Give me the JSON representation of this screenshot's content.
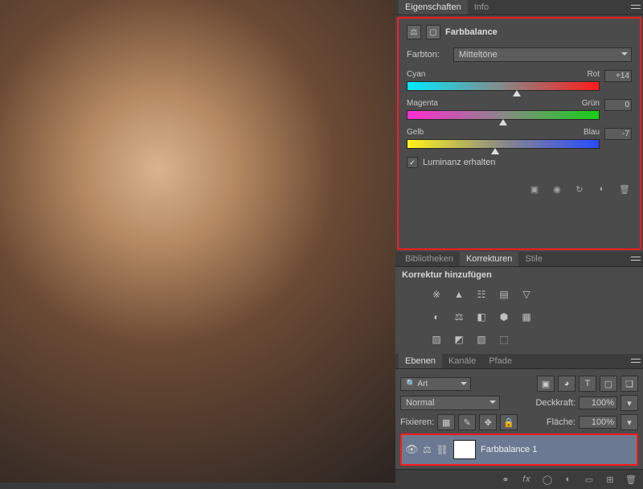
{
  "properties": {
    "tab_eigenschaften": "Eigenschaften",
    "tab_info": "Info",
    "title": "Farbbalance",
    "tone_label": "Farbton:",
    "tone_selected": "Mitteltöne",
    "sliders": {
      "cyan_red": {
        "left": "Cyan",
        "right": "Rot",
        "value": "+14",
        "pos": 57
      },
      "mag_green": {
        "left": "Magenta",
        "right": "Grün",
        "value": "0",
        "pos": 50
      },
      "yel_blue": {
        "left": "Gelb",
        "right": "Blau",
        "value": "-7",
        "pos": 46
      }
    },
    "preserve_lum": "Luminanz erhalten"
  },
  "corrections": {
    "tab_bibliotheken": "Bibliotheken",
    "tab_korrekturen": "Korrekturen",
    "tab_stile": "Stile",
    "heading": "Korrektur hinzufügen",
    "icons_row1": [
      "※",
      "▲",
      "☷",
      "▤",
      "▽"
    ],
    "icons_row2": [
      "◐",
      "⚖",
      "◧",
      "⬢",
      "▦"
    ],
    "icons_row3": [
      "▨",
      "◩",
      "▧",
      "⬚"
    ]
  },
  "layers": {
    "tab_ebenen": "Ebenen",
    "tab_kanaele": "Kanäle",
    "tab_pfade": "Pfade",
    "filter_label": "Art",
    "mode": "Normal",
    "opacity_label": "Deckkraft:",
    "opacity_value": "100%",
    "lock_label": "Fixieren:",
    "fill_label": "Fläche:",
    "fill_value": "100%",
    "layer_name": "Farbbalance 1",
    "filter_icons": [
      "▣",
      "◕",
      "T",
      "▢",
      "❏"
    ],
    "lock_icons": [
      "▦",
      "✎",
      "✥",
      "🔒"
    ]
  }
}
